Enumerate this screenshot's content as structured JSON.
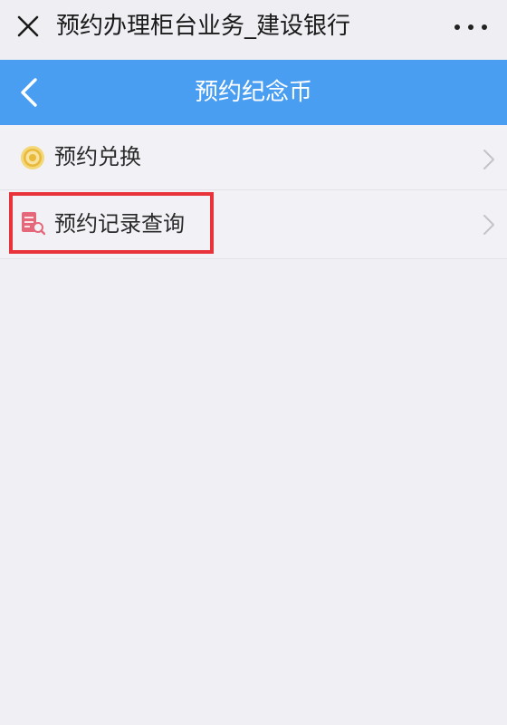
{
  "topbar": {
    "title": "预约办理柜台业务_建设银行",
    "close_icon": "close-icon",
    "more_icon": "more-icon"
  },
  "header": {
    "title": "预约纪念币",
    "back_icon": "chevron-left-icon",
    "color": "#4a9ef2"
  },
  "list": {
    "items": [
      {
        "label": "预约兑换",
        "icon": "coin-icon"
      },
      {
        "label": "预约记录查询",
        "icon": "document-search-icon"
      }
    ]
  },
  "highlight_color": "#e8333a"
}
